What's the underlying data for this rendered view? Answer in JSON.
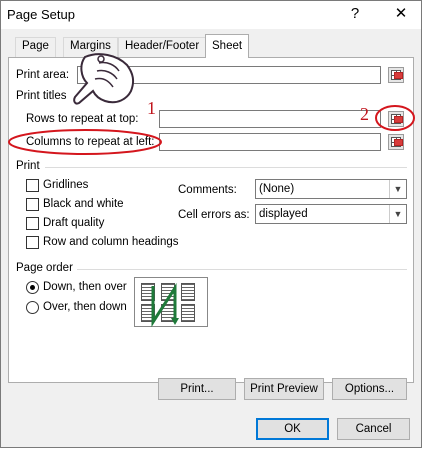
{
  "window": {
    "title": "Page Setup",
    "help": "?",
    "close": "✕"
  },
  "tabs": [
    {
      "label": "Page"
    },
    {
      "label": "Margins"
    },
    {
      "label": "Header/Footer"
    },
    {
      "label": "Sheet"
    }
  ],
  "sheet": {
    "print_area_label": "Print area:",
    "print_area_value": "",
    "print_titles_label": "Print titles",
    "rows_repeat_label": "Rows to repeat at top:",
    "rows_repeat_value": "",
    "cols_repeat_label": "Columns to repeat at left:",
    "cols_repeat_value": "",
    "print_section": "Print",
    "checkboxes": [
      {
        "label": "Gridlines",
        "checked": false
      },
      {
        "label": "Black and white",
        "checked": false
      },
      {
        "label": "Draft quality",
        "checked": false
      },
      {
        "label": "Row and column headings",
        "checked": false
      }
    ],
    "comments_label": "Comments:",
    "comments_value": "(None)",
    "cell_errors_label": "Cell errors as:",
    "cell_errors_value": "displayed",
    "page_order_section": "Page order",
    "order_options": [
      {
        "label": "Down, then over",
        "selected": true
      },
      {
        "label": "Over, then down",
        "selected": false
      }
    ]
  },
  "buttons": {
    "print": "Print...",
    "print_preview": "Print Preview",
    "options": "Options...",
    "ok": "OK",
    "cancel": "Cancel"
  },
  "annotations": {
    "num1": "1",
    "num2": "2",
    "accent_color": "#d4161d"
  }
}
